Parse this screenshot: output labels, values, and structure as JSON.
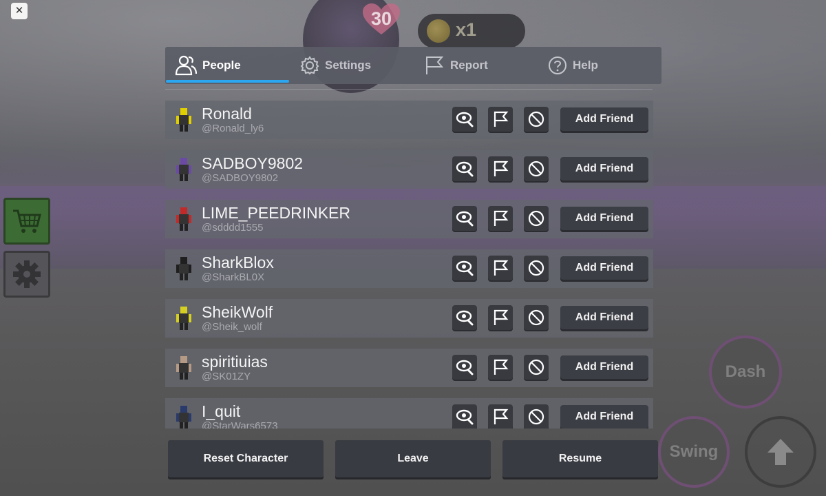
{
  "hud": {
    "close_label": "✕",
    "hearts": "30",
    "coins": "x1"
  },
  "side": {
    "shop_icon": "cart-icon",
    "settings_icon": "gear-icon"
  },
  "actions": {
    "dash": "Dash",
    "swing": "Swing",
    "jump_icon": "arrow-up-icon"
  },
  "tabs": [
    {
      "label": "People",
      "icon": "people-icon",
      "active": true
    },
    {
      "label": "Settings",
      "icon": "gear-icon",
      "active": false
    },
    {
      "label": "Report",
      "icon": "flag-icon",
      "active": false
    },
    {
      "label": "Help",
      "icon": "help-icon",
      "active": false
    }
  ],
  "players": [
    {
      "name": "Ronald",
      "username": "@Ronald_ly6",
      "add_label": "Add Friend",
      "avatar_color": "#e0d000"
    },
    {
      "name": "SADBOY9802",
      "username": "@SADBOY9802",
      "add_label": "Add Friend",
      "avatar_color": "#6b4aa6"
    },
    {
      "name": "LIME_PEEDRINKER",
      "username": "@sdddd1555",
      "add_label": "Add Friend",
      "avatar_color": "#c22a2a"
    },
    {
      "name": "SharkBlox",
      "username": "@SharkBL0X",
      "add_label": "Add Friend",
      "avatar_color": "#1f1f1f"
    },
    {
      "name": "SheikWolf",
      "username": "@Sheik_wolf",
      "add_label": "Add Friend",
      "avatar_color": "#d5cf22"
    },
    {
      "name": "spiritiuias",
      "username": "@SK01ZY",
      "add_label": "Add Friend",
      "avatar_color": "#b59a86"
    },
    {
      "name": "I_quit",
      "username": "@StarWars6573",
      "add_label": "Add Friend",
      "avatar_color": "#2a3b6b"
    }
  ],
  "row_actions": {
    "inspect_icon": "inspect-icon",
    "report_icon": "flag-icon",
    "block_icon": "block-icon"
  },
  "bottom": {
    "reset": "Reset Character",
    "leave": "Leave",
    "resume": "Resume"
  },
  "colors": {
    "accent": "#2aa7f0",
    "panel": "#5a5c66",
    "button": "#393b42"
  }
}
